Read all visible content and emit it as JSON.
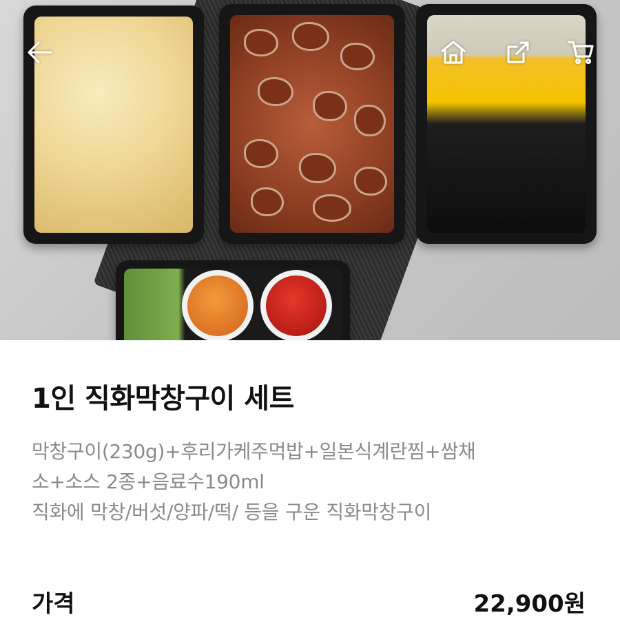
{
  "header": {
    "back_icon": "arrow-left-icon",
    "home_icon": "home-icon",
    "share_icon": "share-icon",
    "cart_icon": "cart-icon",
    "icon_color": "#ffffff"
  },
  "product": {
    "title": "1인 직화막창구이 세트",
    "description_lines": [
      "막창구이(230g)+후리가케주먹밥+일본식계란찜+쌈채",
      "소+소스 2종+음료수190ml",
      "직화에 막창/버섯/양파/떡/ 등을 구운 직화막창구이"
    ],
    "price_label": "가격",
    "price_value": "22,900원"
  }
}
